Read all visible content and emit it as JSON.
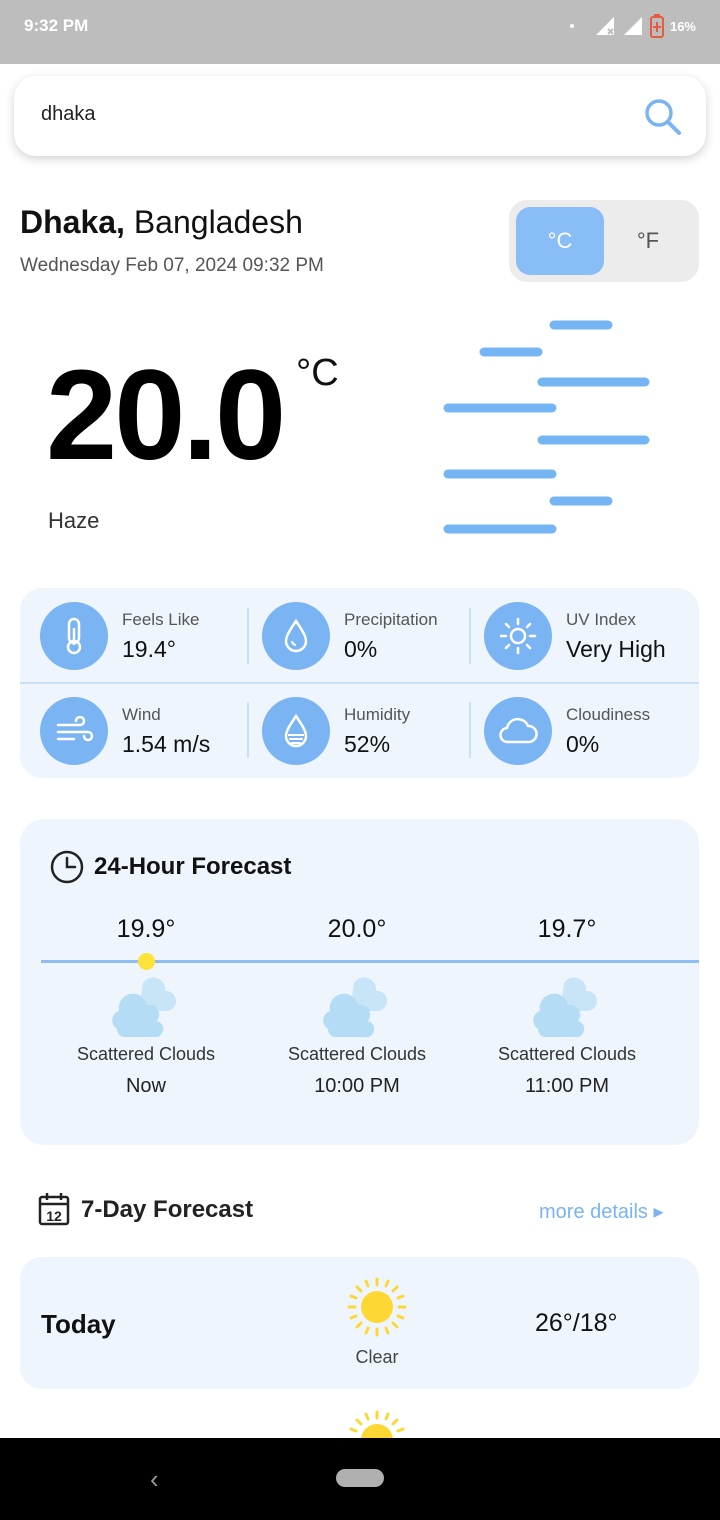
{
  "status_bar": {
    "time": "9:32 PM",
    "battery": "16%"
  },
  "search": {
    "value": "dhaka",
    "placeholder": ""
  },
  "location": {
    "city": "Dhaka,",
    "country": "Bangladesh",
    "datetime": "Wednesday Feb 07, 2024  09:32 PM"
  },
  "units": {
    "celsius": "°C",
    "fahrenheit": "°F",
    "selected": "°C"
  },
  "current": {
    "temperature": "20.0",
    "unit": "°C",
    "condition": "Haze"
  },
  "stats": [
    {
      "label": "Feels Like",
      "value": "19.4°",
      "icon": "thermometer-icon"
    },
    {
      "label": "Precipitation",
      "value": "0%",
      "icon": "droplet-icon"
    },
    {
      "label": "UV Index",
      "value": "Very High",
      "icon": "sun-icon"
    },
    {
      "label": "Wind",
      "value": "1.54 m/s",
      "icon": "wind-icon"
    },
    {
      "label": "Humidity",
      "value": "52%",
      "icon": "humidity-icon"
    },
    {
      "label": "Cloudiness",
      "value": "0%",
      "icon": "cloud-icon"
    }
  ],
  "hourly": {
    "title": "24-Hour Forecast",
    "items": [
      {
        "temp": "19.9°",
        "desc": "Scattered Clouds",
        "time": "Now"
      },
      {
        "temp": "20.0°",
        "desc": "Scattered Clouds",
        "time": "10:00 PM"
      },
      {
        "temp": "19.7°",
        "desc": "Scattered Clouds",
        "time": "11:00 PM"
      }
    ]
  },
  "daily": {
    "title": "7-Day Forecast",
    "more": "more details ▸",
    "calendar_day": "12",
    "items": [
      {
        "day": "Today",
        "condition": "Clear",
        "range": "26°/18°"
      }
    ]
  },
  "colors": {
    "accent": "#7ab4f2",
    "card_bg": "#eef5fd",
    "sun": "#fdd835"
  }
}
